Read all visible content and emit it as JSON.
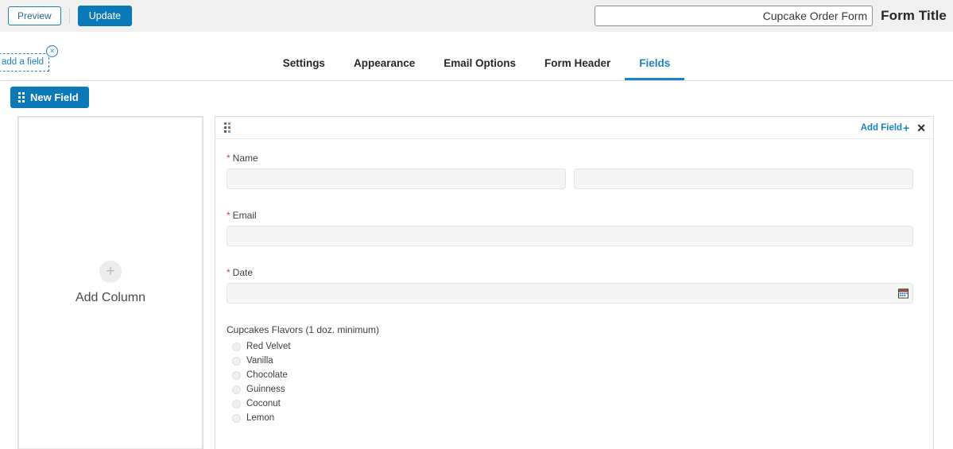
{
  "topbar": {
    "preview_label": "Preview",
    "update_label": "Update",
    "form_title_value": "Cupcake Order Form",
    "form_title_placeholder": "Form Title",
    "form_title_label": "Form Title"
  },
  "tabs": [
    {
      "label": "Settings",
      "active": false
    },
    {
      "label": "Appearance",
      "active": false
    },
    {
      "label": "Email Options",
      "active": false
    },
    {
      "label": "Form Header",
      "active": false
    },
    {
      "label": "Fields",
      "active": true
    }
  ],
  "tooltip": {
    "text": "he form to add a field",
    "close_label": "×"
  },
  "toolbar": {
    "new_field_label": "New Field"
  },
  "column_placeholder": {
    "plus_glyph": "+",
    "label": "Add Column"
  },
  "form_panel": {
    "add_field_label": "Add Field",
    "add_field_plus": "+",
    "close_label": "✕",
    "fields": [
      {
        "label": "Name",
        "required": true,
        "type": "two-column-text"
      },
      {
        "label": "Email",
        "required": true,
        "type": "text"
      },
      {
        "label": "Date",
        "required": true,
        "type": "date"
      }
    ],
    "flavors": {
      "label": "Cupcakes Flavors (1 doz. minimum)",
      "options": [
        "Red Velvet",
        "Vanilla",
        "Chocolate",
        "Guinness",
        "Coconut",
        "Lemon"
      ]
    }
  },
  "colors": {
    "accent": "#1b82c4",
    "button_blue": "#0b79b8",
    "topbar_bg": "#f0f0f0",
    "required_red": "#cc4b37",
    "input_bg": "#f5f5f5"
  }
}
